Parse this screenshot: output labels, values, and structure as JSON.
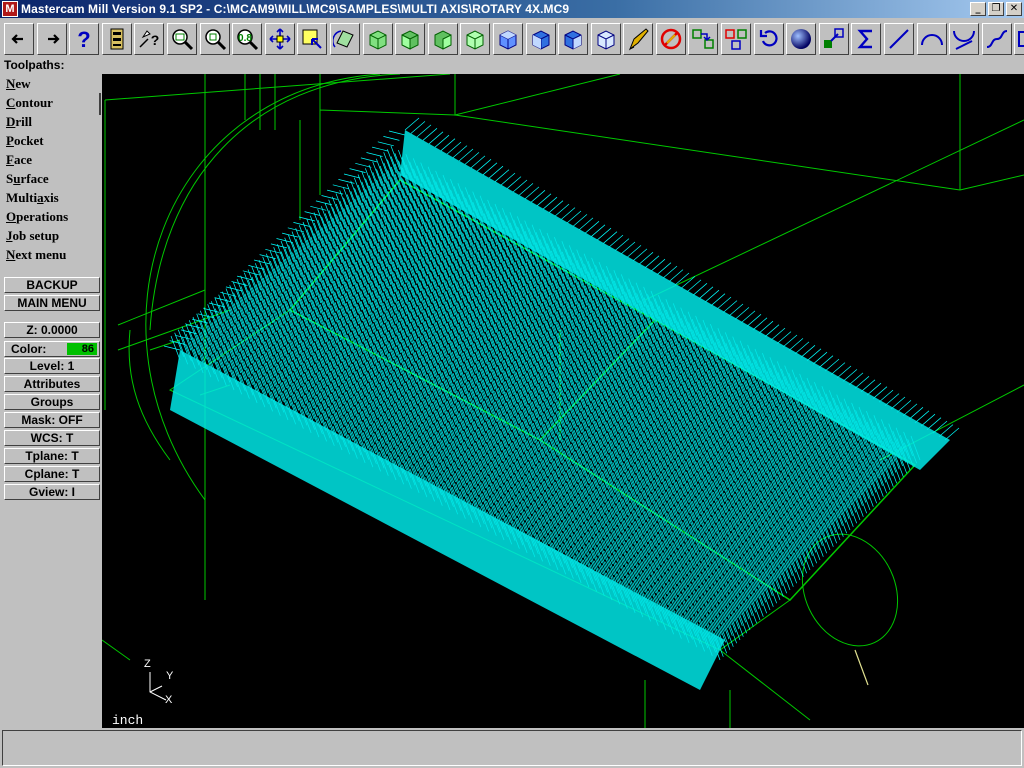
{
  "window": {
    "app_icon_text": "M",
    "title": "Mastercam Mill Version 9.1 SP2 - C:\\MCAM9\\MILL\\MC9\\SAMPLES\\MULTI AXIS\\ROTARY 4X.MC9",
    "buttons": [
      "minimize",
      "restore",
      "close"
    ]
  },
  "toolbar": {
    "buttons": [
      "back-arrow-icon",
      "forward-arrow-icon",
      "help-icon",
      "toolbar-page-icon",
      "analyze-icon",
      "zoom-window-icon",
      "zoom-out-icon",
      "zoom-fit-icon",
      "pan-icon",
      "select-icon",
      "rotate-view-icon",
      "view-top-icon",
      "view-front-icon",
      "view-side-icon",
      "view-iso-icon",
      "solid-top-icon",
      "solid-front-icon",
      "solid-side-icon",
      "solid-iso-icon",
      "erase-icon",
      "no-entry-icon",
      "transform-icon",
      "group-icon",
      "undo-icon",
      "shade-sphere-icon",
      "level-icon",
      "sum-icon",
      "line-icon",
      "arc-icon",
      "trim-icon",
      "spline-icon",
      "rectangle-icon"
    ]
  },
  "prompt": {
    "label": "Toolpaths:"
  },
  "menu": {
    "items": [
      {
        "pre": "",
        "key": "N",
        "post": "ew"
      },
      {
        "pre": "",
        "key": "C",
        "post": "ontour"
      },
      {
        "pre": "",
        "key": "D",
        "post": "rill"
      },
      {
        "pre": "",
        "key": "P",
        "post": "ocket"
      },
      {
        "pre": "",
        "key": "F",
        "post": "ace"
      },
      {
        "pre": "S",
        "key": "u",
        "post": "rface"
      },
      {
        "pre": "Multi",
        "key": "a",
        "post": "xis"
      },
      {
        "pre": "",
        "key": "O",
        "post": "perations"
      },
      {
        "pre": "",
        "key": "J",
        "post": "ob setup"
      },
      {
        "pre": "",
        "key": "N",
        "post": "ext menu"
      }
    ],
    "backup_label": "BACKUP",
    "main_menu_label": "MAIN MENU",
    "z_label": "Z:  0.0000",
    "color_label": "Color:",
    "color_value": "86",
    "color_swatch": "#00c000",
    "level_label": "Level:  1",
    "attributes_label": "Attributes",
    "groups_label": "Groups",
    "mask_label": "Mask:  OFF",
    "wcs_label": "WCS:   T",
    "tplane_label": "Tplane:  T",
    "cplane_label": "Cplane:  T",
    "gview_label": "Gview:   I"
  },
  "viewport": {
    "units": "inch",
    "axes": {
      "z": "Z",
      "y": "Y",
      "x": "X"
    },
    "geometry_color": "#00c800",
    "toolpath_color": "#00ffff",
    "background": "#000000"
  }
}
